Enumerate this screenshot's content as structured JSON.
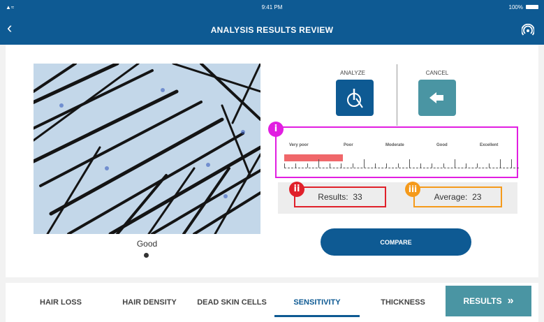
{
  "status": {
    "time": "9:41 PM",
    "battery": "100%"
  },
  "header": {
    "title": "ANALYSIS RESULTS REVIEW",
    "back_icon": "chevron-left-icon",
    "cast_icon": "broadcast-icon"
  },
  "image": {
    "caption": "Good"
  },
  "actions": {
    "analyze_label": "ANALYZE",
    "cancel_label": "CANCEL"
  },
  "scale": {
    "labels": [
      "Very poor",
      "Poor",
      "Moderate",
      "Good",
      "Excellent"
    ],
    "level": 0.25,
    "badge": "i"
  },
  "results": {
    "results_badge": "ii",
    "results_label": "Results:",
    "results_value": "33",
    "average_badge": "iii",
    "average_label": "Average:",
    "average_value": "23"
  },
  "compare_label": "COMPARE",
  "tabs": {
    "hair_loss": "HAIR LOSS",
    "hair_density": "HAIR DENSITY",
    "dead_skin_cells": "DEAD SKIN CELLS",
    "sensitivity": "SENSITIVITY",
    "thickness": "THICKNESS",
    "results": "RESULTS",
    "results_icon": "double-chevron-right-icon"
  },
  "colors": {
    "primary": "#0e5a93",
    "teal": "#4a95a3",
    "scale_fill": "#f0676a",
    "badge_magenta": "#e11ee1",
    "badge_red": "#e0202a",
    "badge_orange": "#f59a1b"
  }
}
